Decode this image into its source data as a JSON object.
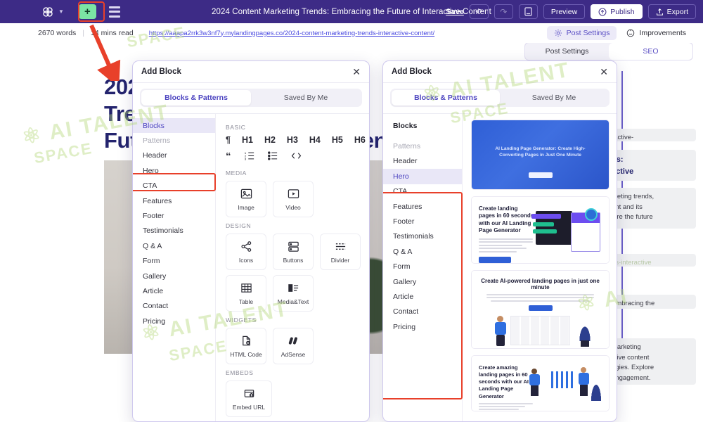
{
  "topbar": {
    "logo_icon": "infinity-flower-logo-icon",
    "chevron_icon": "chevron-down-icon",
    "add_block_label": "+",
    "layers_icon": "layers-icon",
    "doc_title": "2024 Content Marketing Trends: Embracing the Future of Interactive Content",
    "save_label": "Save",
    "undo_icon": "undo-icon",
    "redo_icon": "redo-icon",
    "device_icon": "tablet-icon",
    "preview_label": "Preview",
    "publish_label": "Publish",
    "publish_icon": "cloud-upload-icon",
    "export_label": "Export",
    "export_icon": "export-icon"
  },
  "subbar": {
    "words": "2670 words",
    "read_time": "14 mins read",
    "url": "https://aaapa2rrk3w3nf7y.mylandingpages.co/2024-content-marketing-trends-interactive-content/",
    "post_settings_label": "Post Settings",
    "post_settings_icon": "gear-icon",
    "improvements_label": "Improvements",
    "improvements_icon": "smiley-idea-icon"
  },
  "background": {
    "heading": "2024 Content Marketing Trends: Embracing the Future of Interactive Content",
    "rail_tabs": [
      "Post Settings",
      "SEO"
    ],
    "rail_selected_tab": "SEO",
    "rail_blocks": [
      "ractive-",
      "ds:\nactive",
      "rketing trends,\nent and its\nlore the future",
      "ds-interactive",
      "Embracing the",
      "marketing\nctive content\negies. Explore\nengagement."
    ]
  },
  "modal1": {
    "title": "Add Block",
    "close_icon": "close-icon",
    "tabs": [
      "Blocks & Patterns",
      "Saved By Me"
    ],
    "selected_tab": "Blocks & Patterns",
    "sidebar": [
      {
        "label": "Blocks",
        "state": "selected"
      },
      {
        "label": "Patterns",
        "state": "muted"
      },
      {
        "label": "Header",
        "state": "normal"
      },
      {
        "label": "Hero",
        "state": "normal"
      },
      {
        "label": "CTA",
        "state": "normal"
      },
      {
        "label": "Features",
        "state": "normal"
      },
      {
        "label": "Footer",
        "state": "normal"
      },
      {
        "label": "Testimonials",
        "state": "normal"
      },
      {
        "label": "Q & A",
        "state": "normal"
      },
      {
        "label": "Form",
        "state": "normal"
      },
      {
        "label": "Gallery",
        "state": "normal"
      },
      {
        "label": "Article",
        "state": "normal"
      },
      {
        "label": "Contact",
        "state": "normal"
      },
      {
        "label": "Pricing",
        "state": "normal"
      }
    ],
    "sections": {
      "basic_label": "BASIC",
      "basic_row1": [
        "¶",
        "H1",
        "H2",
        "H3",
        "H4",
        "H5",
        "H6"
      ],
      "basic_row2": [
        "quote-icon",
        "ordered-list-icon",
        "unordered-list-icon",
        "code-icon"
      ],
      "media_label": "MEDIA",
      "media_tiles": [
        {
          "label": "Image",
          "icon": "image-icon"
        },
        {
          "label": "Video",
          "icon": "video-icon"
        }
      ],
      "design_label": "DESIGN",
      "design_tiles": [
        {
          "label": "Icons",
          "icon": "share-nodes-icon"
        },
        {
          "label": "Buttons",
          "icon": "buttons-icon"
        },
        {
          "label": "Divider",
          "icon": "divider-icon"
        },
        {
          "label": "Table",
          "icon": "table-grid-icon"
        },
        {
          "label": "Media&Text",
          "icon": "media-text-icon"
        }
      ],
      "widgets_label": "WIDGETS",
      "widget_tiles": [
        {
          "label": "HTML Code",
          "icon": "html-file-icon"
        },
        {
          "label": "AdSense",
          "icon": "adsense-icon"
        }
      ],
      "embeds_label": "EMBEDS",
      "embed_tiles": [
        {
          "label": "Embed URL",
          "icon": "embed-window-icon"
        }
      ]
    }
  },
  "modal2": {
    "title": "Add Block",
    "close_icon": "close-icon",
    "tabs": [
      "Blocks & Patterns",
      "Saved By Me"
    ],
    "selected_tab": "Blocks & Patterns",
    "sidebar": [
      {
        "label": "Blocks",
        "state": "head"
      },
      {
        "label": "Patterns",
        "state": "muted"
      },
      {
        "label": "Header",
        "state": "normal"
      },
      {
        "label": "Hero",
        "state": "selected"
      },
      {
        "label": "CTA",
        "state": "normal"
      },
      {
        "label": "Features",
        "state": "normal"
      },
      {
        "label": "Footer",
        "state": "normal"
      },
      {
        "label": "Testimonials",
        "state": "normal"
      },
      {
        "label": "Q & A",
        "state": "normal"
      },
      {
        "label": "Form",
        "state": "normal"
      },
      {
        "label": "Gallery",
        "state": "normal"
      },
      {
        "label": "Article",
        "state": "normal"
      },
      {
        "label": "Contact",
        "state": "normal"
      },
      {
        "label": "Pricing",
        "state": "normal"
      }
    ],
    "previews": [
      {
        "title": "AI Landing Page Generator: Create High-Converting Pages in Just One Minute",
        "style": "dark-blue-hero"
      },
      {
        "title": "Create landing pages in 60 seconds with our AI Landing Page Generator",
        "style": "split-left-text"
      },
      {
        "title": "Create AI-powered landing pages in just one minute",
        "style": "centered-illustration"
      },
      {
        "title": "Create amazing landing pages in 60 seconds with our AI Landing Page Generator",
        "style": "split-illustration"
      }
    ]
  },
  "annotations": {
    "arrow_color": "#e8402a",
    "highlight_color": "#e8402a",
    "targets": [
      "add-block-button",
      "blocks-sidebar-item",
      "patterns-category-list"
    ]
  },
  "watermarks": [
    "AI TALENT SPACE",
    "AI TALENT SPACE",
    "AI TALENT SPACE"
  ]
}
